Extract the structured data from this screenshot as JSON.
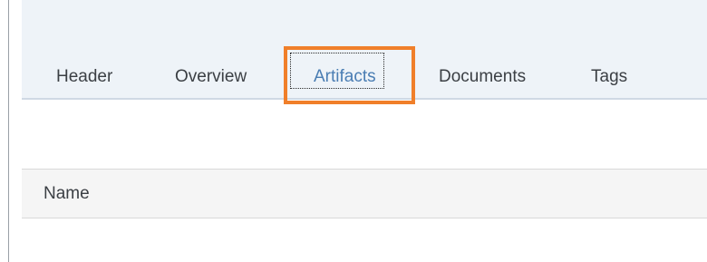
{
  "tabs": [
    {
      "label": "Header"
    },
    {
      "label": "Overview"
    },
    {
      "label": "Artifacts",
      "selected": true
    },
    {
      "label": "Documents"
    },
    {
      "label": "Tags"
    }
  ],
  "table": {
    "columns": [
      "Name"
    ]
  },
  "colors": {
    "highlight": "#f07f2a",
    "active_tab": "#4a7db3",
    "tabbar_bg": "#eef3f8"
  }
}
